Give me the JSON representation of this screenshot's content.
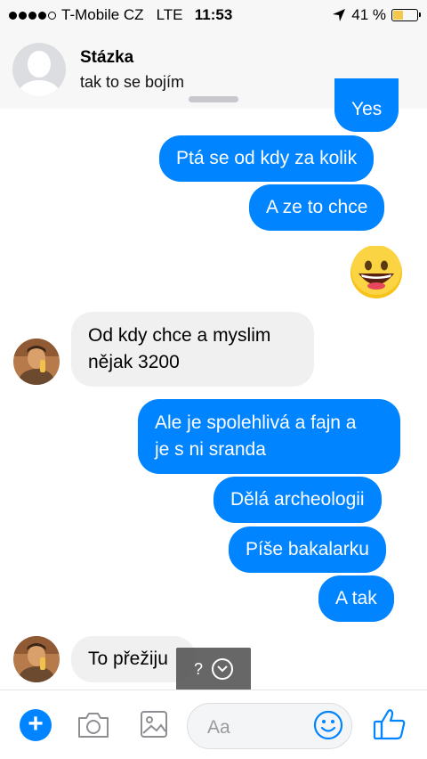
{
  "status_bar": {
    "carrier": "T-Mobile CZ",
    "network": "LTE",
    "time": "11:53",
    "battery": "41 %",
    "battery_level": 0.41
  },
  "header": {
    "contact_name": "Stázka",
    "contact_status": "tak to se bojím"
  },
  "messages": [
    {
      "id": "m0",
      "side": "out",
      "text": "Yes"
    },
    {
      "id": "m1",
      "side": "out",
      "text": "Ptá se od kdy za kolik"
    },
    {
      "id": "m2",
      "side": "out",
      "text": "A ze to chce"
    },
    {
      "id": "m4",
      "side": "in",
      "text": "Od kdy chce a myslim\nnějak 3200"
    },
    {
      "id": "m5",
      "side": "out",
      "text": "Ale je spolehlivá a fajn a\nje s ni sranda"
    },
    {
      "id": "m6",
      "side": "out",
      "text": "Dělá archeologii"
    },
    {
      "id": "m7",
      "side": "out",
      "text": "Píše bakalarku"
    },
    {
      "id": "m8",
      "side": "out",
      "text": "A tak"
    },
    {
      "id": "m9",
      "side": "in",
      "text": "To přežiju"
    }
  ],
  "scroll_popup": {
    "label": "?"
  },
  "composer": {
    "placeholder": "Aa"
  },
  "colors": {
    "accent": "#0084ff",
    "incoming_bubble": "#f1f0f0",
    "emoji_yellow": "#f7c21a"
  }
}
